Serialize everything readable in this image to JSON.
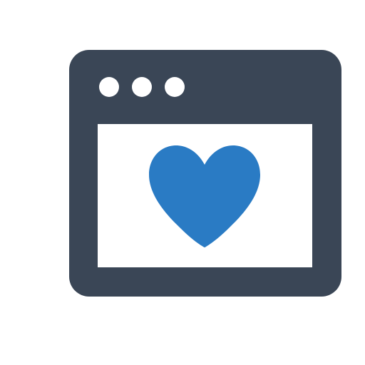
{
  "icon": {
    "name": "browser-window-heart-icon",
    "colors": {
      "frame": "#3a4656",
      "content": "#ffffff",
      "dots": "#ffffff",
      "heart": "#2a7bc4"
    },
    "window_dots": [
      "dot",
      "dot",
      "dot"
    ],
    "content_icon": "heart-icon"
  }
}
